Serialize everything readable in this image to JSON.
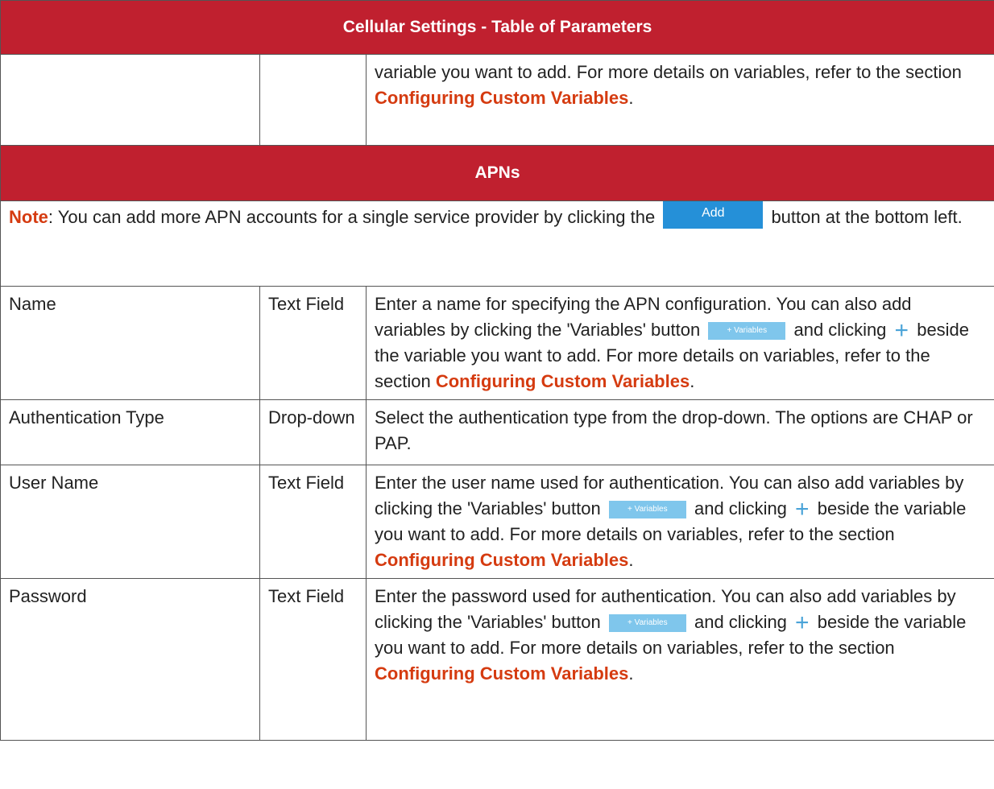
{
  "table_title": "Cellular Settings - Table of Parameters",
  "continuation": {
    "text": "variable you want to add. For more details on variables, refer to the section ",
    "link": "Configuring Custom Variables",
    "end": "."
  },
  "section_title": "APNs",
  "note": {
    "label": "Note",
    "text_before": ": You can add more APN accounts for a single service provider by clicking the",
    "button_label": "Add",
    "text_after": "button at the bottom left."
  },
  "variables_button_label": "+ Variables",
  "rows": [
    {
      "name": "Name",
      "type": "Text Field",
      "desc_before": "Enter a name for specifying the APN configuration. You can also add variables by clicking the 'Variables' button",
      "desc_mid": "and clicking",
      "desc_after": "beside the variable you want to add. For more details on variables, refer to the section ",
      "link": "Configuring Custom Variables",
      "end": "."
    },
    {
      "name": "Authentication Type",
      "type": "Drop-down",
      "desc": "Select the authentication type from the drop-down. The options are CHAP or PAP."
    },
    {
      "name": "User Name",
      "type": "Text Field",
      "desc_before": "Enter the user name used for authentication. You can also add variables by clicking the 'Variables' button",
      "desc_mid": "and clicking",
      "desc_after": "beside the variable you want to add. For more details on variables, refer to the section ",
      "link": "Configuring Custom Variables",
      "end": "."
    },
    {
      "name": "Password",
      "type": "Text Field",
      "desc_before": "Enter the password used for authentication. You can also add variables by clicking the 'Variables' button",
      "desc_mid": "and clicking",
      "desc_after": "beside the variable you want to add. For more details on variables, refer to the section ",
      "link": "Configuring Custom Variables",
      "end": "."
    }
  ],
  "colors": {
    "header_bg": "#c0202f",
    "link": "#d53b10",
    "add_button": "#2590d8",
    "variables_button": "#7fc6ec",
    "plus_icon": "#4aa3d8"
  }
}
